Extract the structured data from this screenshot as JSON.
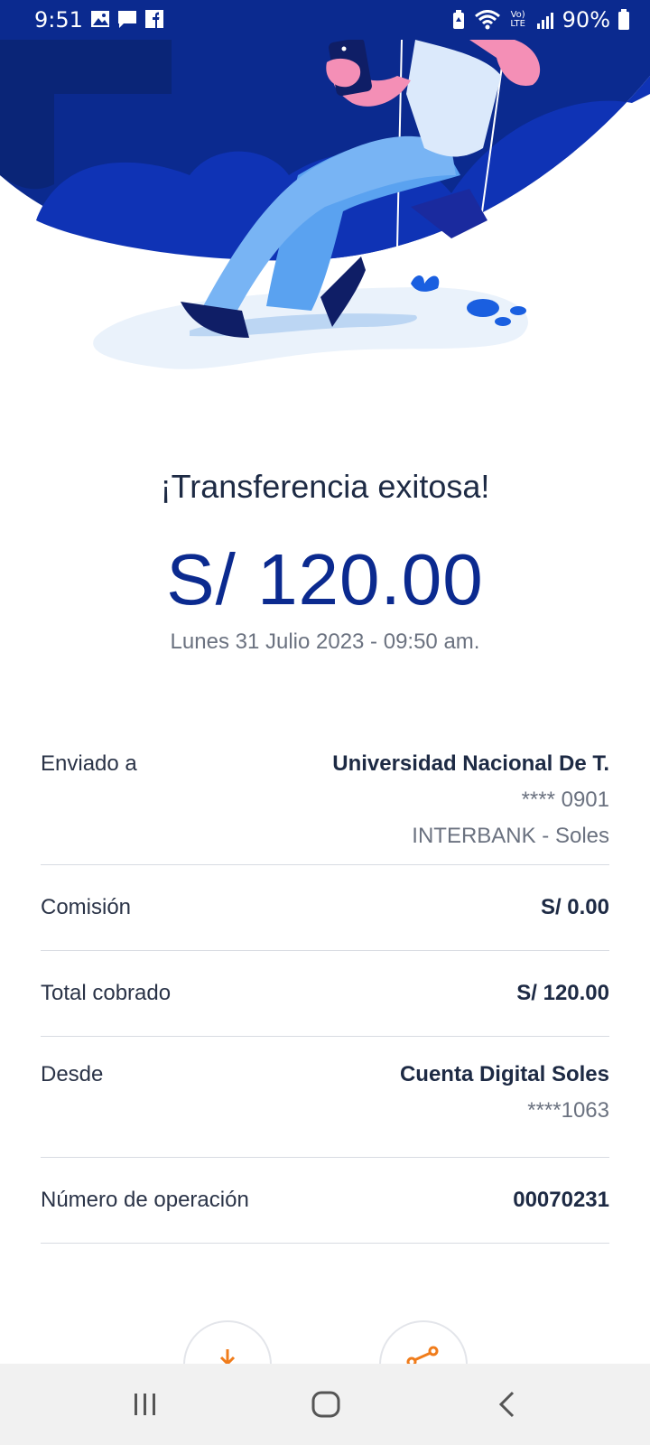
{
  "status_bar": {
    "time": "9:51",
    "battery_text": "90%",
    "volte_text": "Vo) LTE"
  },
  "receipt": {
    "title": "¡Transferencia exitosa!",
    "amount": "S/ 120.00",
    "datetime": "Lunes 31 Julio 2023 - 09:50 am."
  },
  "details": {
    "sent_to_label": "Enviado a",
    "recipient_name": "Universidad Nacional De T.",
    "recipient_account": "**** 0901",
    "recipient_bank": "INTERBANK - Soles",
    "fee_label": "Comisión",
    "fee_value": "S/ 0.00",
    "total_label": "Total cobrado",
    "total_value": "S/ 120.00",
    "from_label": "Desde",
    "from_account_name": "Cuenta Digital Soles",
    "from_account_number": "****1063",
    "operation_label": "Número de operación",
    "operation_value": "00070231"
  },
  "actions": {
    "download_icon": "download-icon",
    "share_icon": "share-icon"
  },
  "colors": {
    "brand_blue": "#0b2a8f",
    "accent_orange": "#f07c1b"
  }
}
